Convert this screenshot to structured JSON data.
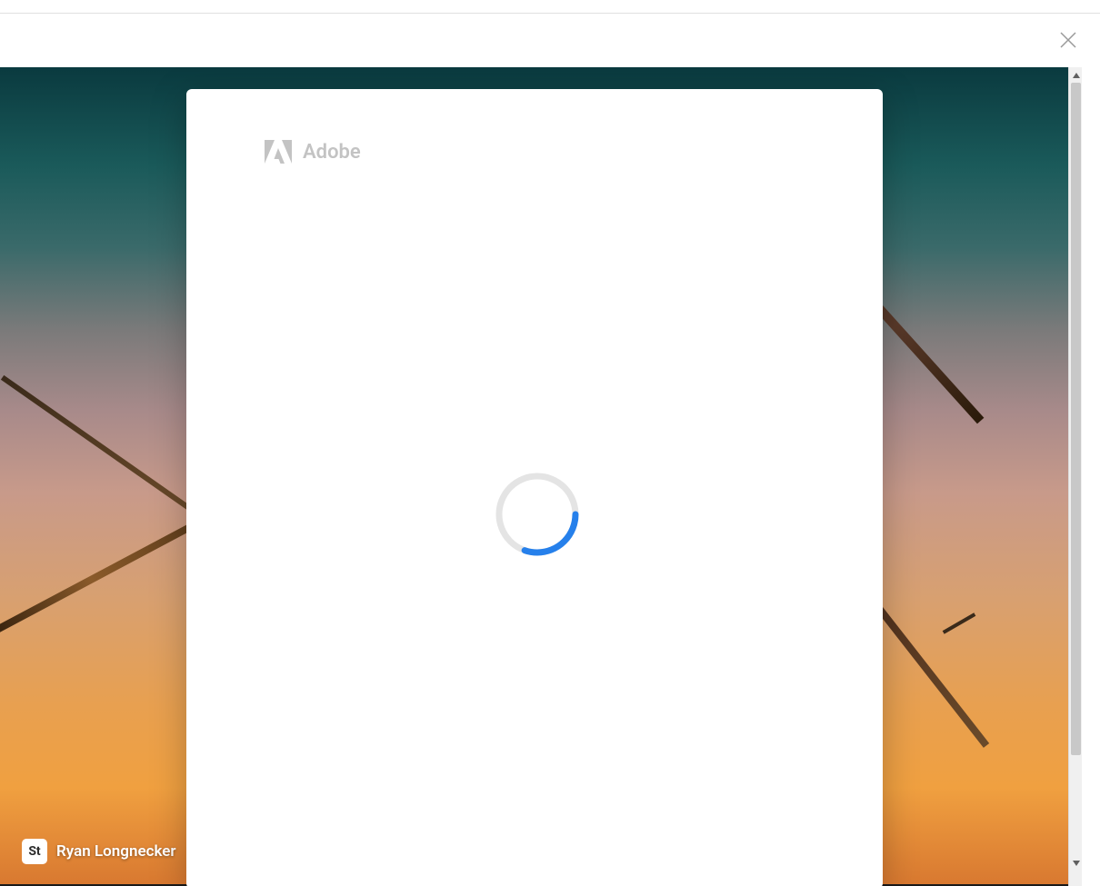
{
  "brand": {
    "name": "Adobe",
    "logo_icon": "adobe-a-icon"
  },
  "attribution": {
    "badge_label": "St",
    "photographer": "Ryan Longnecker"
  },
  "controls": {
    "close_icon": "close-icon"
  },
  "status": {
    "loading": true
  },
  "colors": {
    "spinner_track": "#e4e4e4",
    "spinner_active": "#2680eb",
    "brand_text": "#2c2c2c"
  }
}
